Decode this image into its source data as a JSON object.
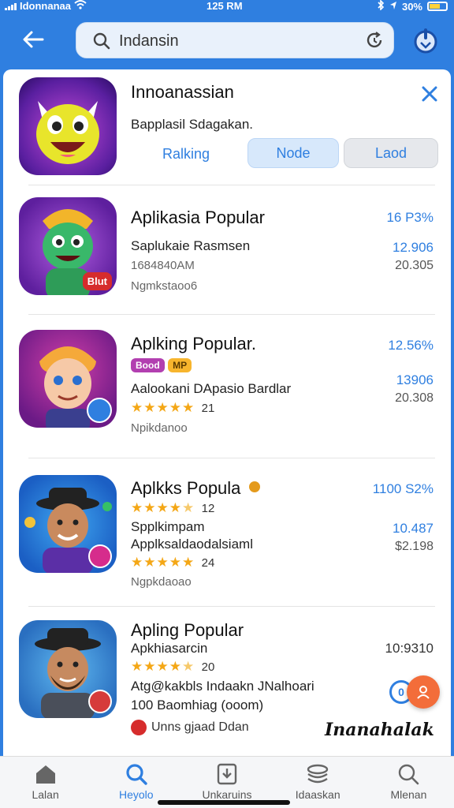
{
  "status_bar": {
    "carrier": "Idonnanaa",
    "time": "125 RM",
    "battery": "30%"
  },
  "search": {
    "query": "Indansin"
  },
  "header_app": {
    "title": "Innoanassian",
    "subtitle": "Bapplasil Sdagakan.",
    "buttons": [
      "Ralking",
      "Node",
      "Laod"
    ]
  },
  "apps": [
    {
      "title": "Aplikasia Popular",
      "subtitle": "Saplukaie Rasmsen",
      "line2": "1684840AM",
      "meta": "Ngmkstaoo6",
      "right_top": "16 P3%",
      "right_mid": "12.906",
      "right_bot": "20.305",
      "badge": "Blut"
    },
    {
      "title": "Aplking Popular.",
      "tags": [
        "Bood",
        "MP"
      ],
      "subtitle": "Aalookani DApasio Bardlar",
      "rating_count": "21",
      "meta": "Npikdanoo",
      "right_top": "12.56%",
      "right_mid": "13906",
      "right_bot": "20.308"
    },
    {
      "title": "Aplkks Popula",
      "rating_count_a": "12",
      "subtitle": "Spplkimpam",
      "line2": "Applksaldaodalsiaml",
      "rating_count_b": "24",
      "meta": "Ngpkdaoao",
      "right_top": "1100 S2%",
      "right_mid": "10.487",
      "right_bot": "$2.198"
    },
    {
      "title": "Apling Popular",
      "subtitle": "Apkhiasarcin",
      "rating_count": "20",
      "line2": "Atg@kakbls Indaakn JNalhoari",
      "line3": "100 Baomhiag (ooom)",
      "meta": "Unns gjaad Ddan",
      "right_top": "10:9310",
      "fab_label": "0"
    }
  ],
  "watermark": "Inanahalak",
  "bottom_nav": [
    {
      "label": "Lalan",
      "icon": "home-icon",
      "active": false
    },
    {
      "label": "Heyolo",
      "icon": "search-icon",
      "active": true
    },
    {
      "label": "Unkaruins",
      "icon": "download-icon",
      "active": false
    },
    {
      "label": "Idaaskan",
      "icon": "stack-icon",
      "active": false
    },
    {
      "label": "Mlenan",
      "icon": "search-icon",
      "active": false
    }
  ],
  "colors": {
    "accent": "#2f7fe0",
    "star": "#f4a716",
    "fab": "#f36d3a"
  }
}
